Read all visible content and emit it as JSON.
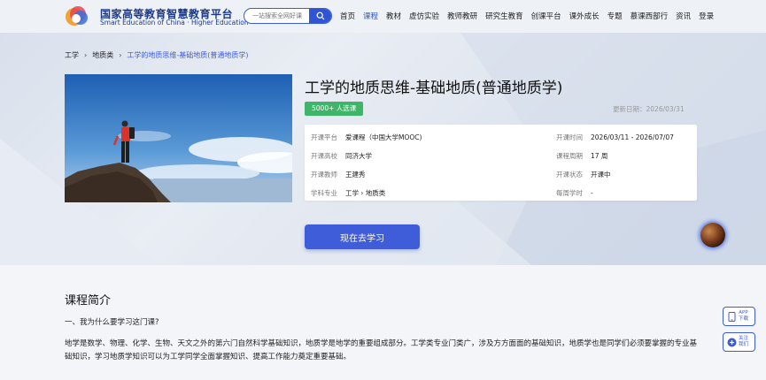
{
  "header": {
    "logo_cn": "国家高等教育智慧教育平台",
    "logo_en": "Smart Education of China · Higher Education",
    "search_placeholder": "一站搜索全网好课",
    "nav": [
      {
        "label": "首页",
        "active": false
      },
      {
        "label": "课程",
        "active": true
      },
      {
        "label": "教材",
        "active": false
      },
      {
        "label": "虚仿实验",
        "active": false
      },
      {
        "label": "教师教研",
        "active": false
      },
      {
        "label": "研究生教育",
        "active": false
      },
      {
        "label": "创课平台",
        "active": false
      },
      {
        "label": "课外成长",
        "active": false
      },
      {
        "label": "专题",
        "active": false
      },
      {
        "label": "慕课西部行",
        "active": false
      },
      {
        "label": "资讯",
        "active": false
      },
      {
        "label": "登录",
        "active": false
      }
    ]
  },
  "breadcrumb": {
    "level1": "工学",
    "level2": "地质类",
    "current": "工学的地质思维-基础地质(普通地质学)"
  },
  "course": {
    "title": "工学的地质思维-基础地质(普通地质学)",
    "enrolled_badge": "5000+ 人选课",
    "update_date": "更新日期：2026/03/31",
    "info_left": [
      {
        "k": "开课平台",
        "v": "爱课程（中国大学MOOC)"
      },
      {
        "k": "开课高校",
        "v": "同济大学"
      },
      {
        "k": "开课教师",
        "v": "王建秀"
      },
      {
        "k": "学科专业",
        "v": "工学 › 地质类"
      }
    ],
    "info_right": [
      {
        "k": "开课时间",
        "v": "2026/03/11 - 2026/07/07"
      },
      {
        "k": "课程周期",
        "v": "17 周"
      },
      {
        "k": "开课状态",
        "v": "开课中"
      },
      {
        "k": "每周学时",
        "v": "-"
      }
    ],
    "go_button": "现在去学习"
  },
  "intro": {
    "section_title": "课程简介",
    "question": "一、我为什么要学习这门课?",
    "paragraph": "地学是数学、物理、化学、生物、天文之外的第六门自然科学基础知识，地质学是地学的重要组成部分。工学类专业门类广，涉及方方面面的基础知识，地质学也是同学们必须要掌握的专业基础知识，学习地质学知识可以为工学同学全面掌握知识、提高工作能力奠定重要基础。"
  },
  "floating": {
    "app_label": "APP\n下载",
    "follow_label": "关注\n我们"
  },
  "colors": {
    "accent": "#2f55d4",
    "badge_green": "#3fb56a"
  }
}
